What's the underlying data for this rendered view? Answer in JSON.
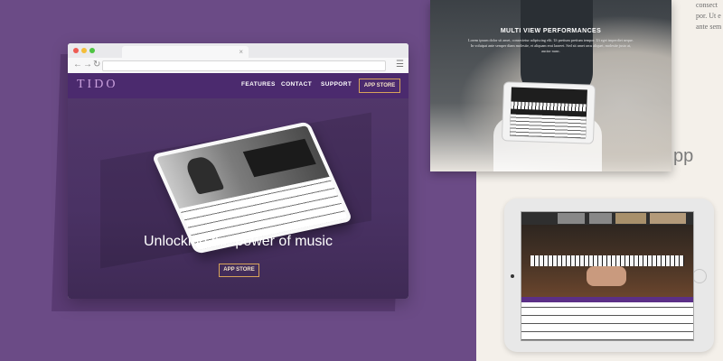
{
  "site": {
    "logo": "TIDO",
    "nav": [
      "FEATURES",
      "CONTACT",
      "SUPPORT"
    ],
    "nav_button": "APP STORE",
    "hero_title": "Unlocking the power of music",
    "hero_button": "APP STORE"
  },
  "panel": {
    "title": "MULTI VIEW PERFORMANCES",
    "description": "Lorem ipsum dolor sit amet, consectetur adipiscing elit. Ut pretium pretium tempor. Ut eget imperdiet neque. In volutpat ante semper diam molestie, et aliquam erat laoreet. Sed sit amet arcu aliquet, molestie justo at, auctor nunc."
  },
  "partials": {
    "top_right_lines": [
      "consect",
      "por. Ut e",
      "ante sem"
    ],
    "pp": "pp"
  },
  "colors": {
    "purple_bg": "#6b4b86",
    "nav_purple": "#4b2a6e",
    "accent_gold": "#d7a35a"
  }
}
